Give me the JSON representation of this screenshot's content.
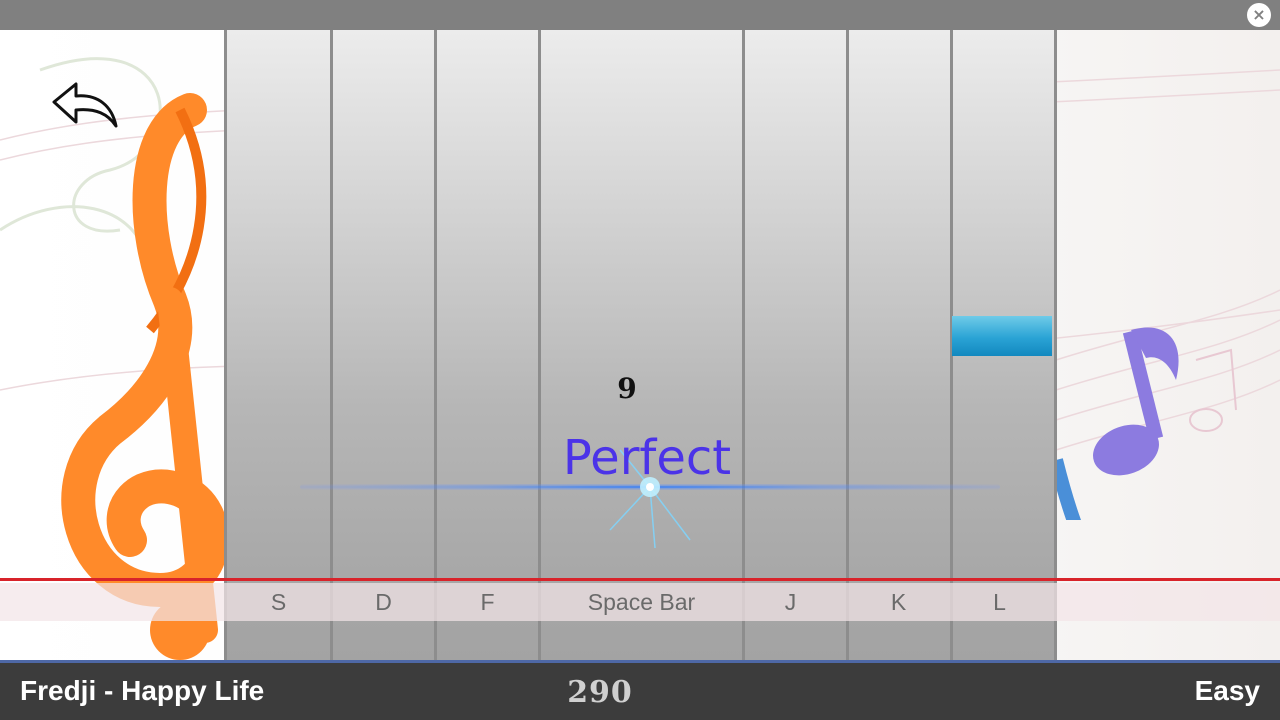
{
  "window": {
    "close_icon": "close-icon",
    "close_glyph": "×"
  },
  "navigation": {
    "back_icon": "back-arrow-icon"
  },
  "lanes": [
    {
      "key": "S"
    },
    {
      "key": "D"
    },
    {
      "key": "F"
    },
    {
      "key": "Space Bar"
    },
    {
      "key": "J"
    },
    {
      "key": "K"
    },
    {
      "key": "L"
    }
  ],
  "active_notes": [
    {
      "lane": "L",
      "color": "#2aa3d5"
    }
  ],
  "feedback": {
    "combo": "9",
    "judgement": "Perfect",
    "judgement_color": "#4b33e8"
  },
  "status": {
    "song": "Fredji - Happy Life",
    "score": "290",
    "difficulty": "Easy"
  },
  "colors": {
    "hitline": "#d8232a",
    "bottom_bar": "#3c3c3c",
    "top_bar": "#808080",
    "clef": "#ff8a2a",
    "note_decoration": "#8c7be0"
  }
}
